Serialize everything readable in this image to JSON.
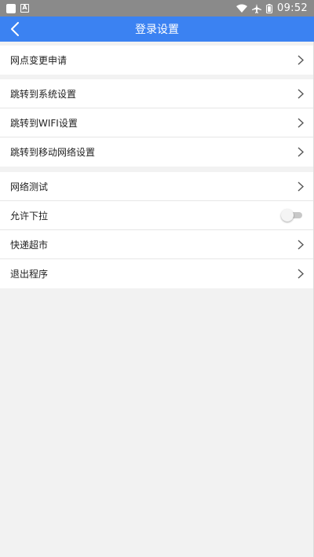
{
  "status_bar": {
    "time": "09:52",
    "icons": [
      "app-square-icon",
      "a-badge-icon",
      "wifi-icon",
      "airplane-icon",
      "battery-icon"
    ],
    "a_badge": "A"
  },
  "header": {
    "title": "登录设置",
    "background": "#3b82f2",
    "back_icon": "chevron-left-icon"
  },
  "groups": [
    {
      "items": [
        {
          "label": "网点变更申请",
          "type": "chevron"
        }
      ]
    },
    {
      "items": [
        {
          "label": "跳转到系统设置",
          "type": "chevron"
        },
        {
          "label": "跳转到WIFI设置",
          "type": "chevron"
        },
        {
          "label": "跳转到移动网络设置",
          "type": "chevron"
        }
      ]
    },
    {
      "items": [
        {
          "label": "网络测试",
          "type": "chevron"
        },
        {
          "label": "允许下拉",
          "type": "toggle",
          "value": false
        },
        {
          "label": "快递超市",
          "type": "chevron"
        },
        {
          "label": "退出程序",
          "type": "chevron"
        }
      ]
    }
  ]
}
